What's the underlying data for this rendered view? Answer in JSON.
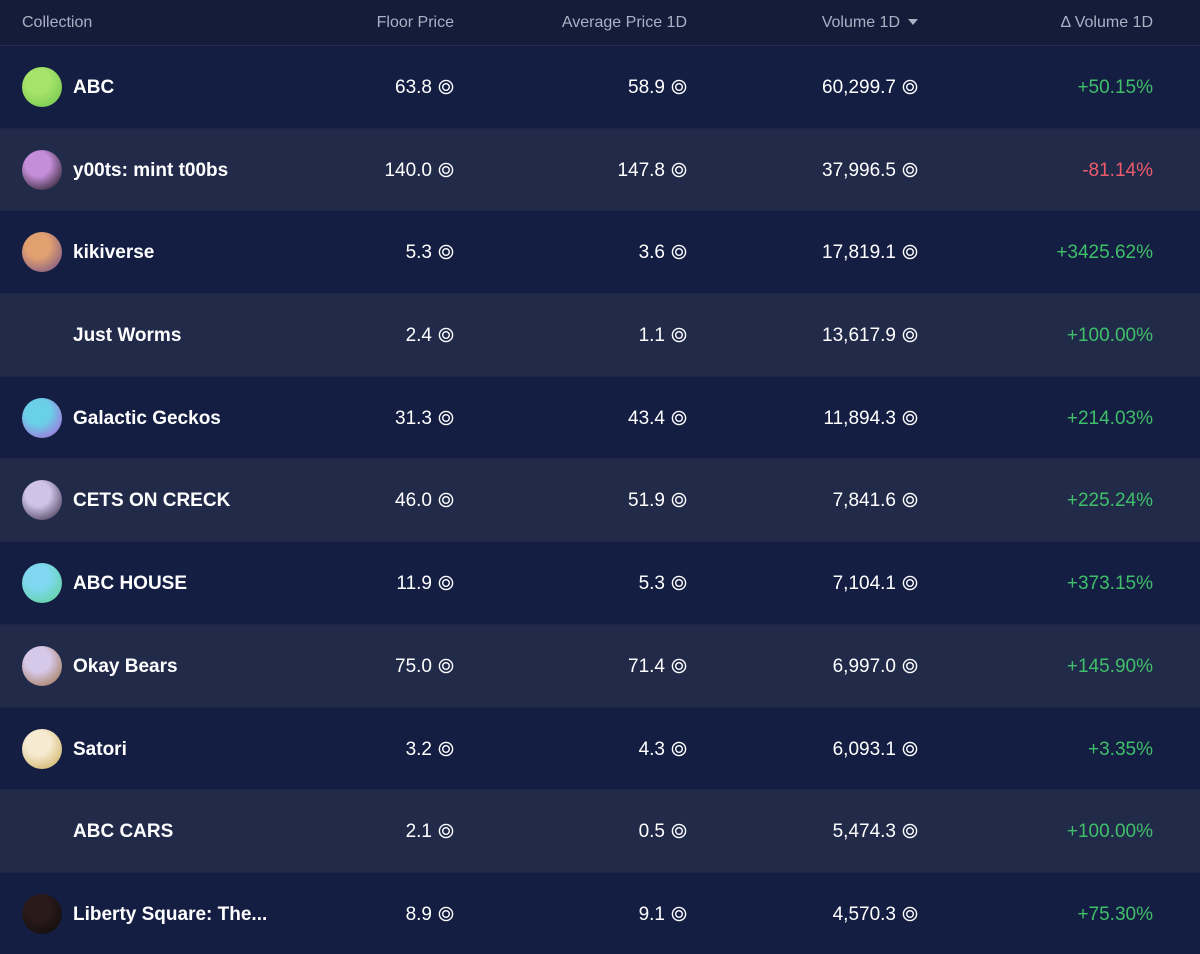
{
  "header": {
    "collection": "Collection",
    "floor_price": "Floor Price",
    "avg_price": "Average Price 1D",
    "volume": "Volume 1D",
    "delta_volume": "Δ Volume 1D"
  },
  "currency_icon": "solana-coin-icon",
  "colors": {
    "background": "#141c3a",
    "row_alt": "#222a4a",
    "positive": "#3fbf6a",
    "negative": "#ef5a6a",
    "header_text": "#aab1c5"
  },
  "rows": [
    {
      "name": "ABC",
      "floor": "63.8",
      "avg": "58.9",
      "volume": "60,299.7",
      "delta": "+50.15%",
      "trend": "pos",
      "avatar": "abc-avatar",
      "avatar_colors": [
        "#a6e36a",
        "#6cc24a"
      ]
    },
    {
      "name": "y00ts: mint t00bs",
      "floor": "140.0",
      "avg": "147.8",
      "volume": "37,996.5",
      "delta": "-81.14%",
      "trend": "neg",
      "avatar": "y00ts-avatar",
      "avatar_colors": [
        "#c48ed8",
        "#0a0a0a"
      ]
    },
    {
      "name": "kikiverse",
      "floor": "5.3",
      "avg": "3.6",
      "volume": "17,819.1",
      "delta": "+3425.62%",
      "trend": "pos",
      "avatar": "kikiverse-avatar",
      "avatar_colors": [
        "#e0a070",
        "#6a4a8a"
      ]
    },
    {
      "name": "Just Worms",
      "floor": "2.4",
      "avg": "1.1",
      "volume": "13,617.9",
      "delta": "+100.00%",
      "trend": "pos",
      "avatar": "",
      "avatar_colors": []
    },
    {
      "name": "Galactic Geckos",
      "floor": "31.3",
      "avg": "43.4",
      "volume": "11,894.3",
      "delta": "+214.03%",
      "trend": "pos",
      "avatar": "galactic-geckos-avatar",
      "avatar_colors": [
        "#6ad0e8",
        "#b05ad8"
      ]
    },
    {
      "name": "CETS ON CRECK",
      "floor": "46.0",
      "avg": "51.9",
      "volume": "7,841.6",
      "delta": "+225.24%",
      "trend": "pos",
      "avatar": "cets-on-creck-avatar",
      "avatar_colors": [
        "#cfc4e8",
        "#2a2038"
      ]
    },
    {
      "name": "ABC HOUSE",
      "floor": "11.9",
      "avg": "5.3",
      "volume": "7,104.1",
      "delta": "+373.15%",
      "trend": "pos",
      "avatar": "abc-house-avatar",
      "avatar_colors": [
        "#7fd8f0",
        "#5ad08a"
      ]
    },
    {
      "name": "Okay Bears",
      "floor": "75.0",
      "avg": "71.4",
      "volume": "6,997.0",
      "delta": "+145.90%",
      "trend": "pos",
      "avatar": "okay-bears-avatar",
      "avatar_colors": [
        "#d6c8e8",
        "#9a6a3a"
      ]
    },
    {
      "name": "Satori",
      "floor": "3.2",
      "avg": "4.3",
      "volume": "6,093.1",
      "delta": "+3.35%",
      "trend": "pos",
      "avatar": "satori-avatar",
      "avatar_colors": [
        "#f6ead0",
        "#c8a850"
      ]
    },
    {
      "name": "ABC CARS",
      "floor": "2.1",
      "avg": "0.5",
      "volume": "5,474.3",
      "delta": "+100.00%",
      "trend": "pos",
      "avatar": "",
      "avatar_colors": []
    },
    {
      "name": "Liberty Square: The...",
      "floor": "8.9",
      "avg": "9.1",
      "volume": "4,570.3",
      "delta": "+75.30%",
      "trend": "pos",
      "avatar": "liberty-square-avatar",
      "avatar_colors": [
        "#2a1a1a",
        "#0a0a0a"
      ]
    }
  ]
}
